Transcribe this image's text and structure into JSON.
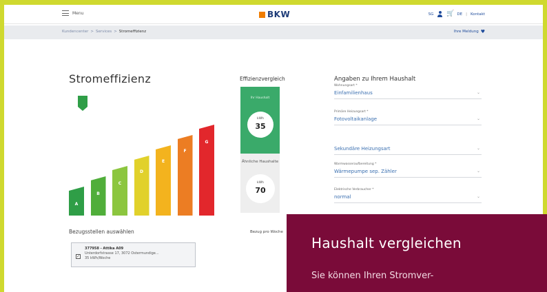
{
  "header": {
    "menu_label": "Menu",
    "logo_text": "BKW",
    "user_short": "SG",
    "language": "DE",
    "separator": "|",
    "contact": "Kontakt"
  },
  "breadcrumb": {
    "items": [
      "Kundencenter",
      "Services",
      "Stromeffizienz"
    ],
    "separator": ">",
    "meldung": "Ihre Meldung"
  },
  "main": {
    "title": "Stromeffizienz",
    "energy_classes": [
      "A",
      "B",
      "C",
      "D",
      "E",
      "F",
      "G"
    ],
    "energy_colors": [
      "#2f9e47",
      "#50ae3a",
      "#8cc63f",
      "#e1d12b",
      "#f3b31e",
      "#ec7d23",
      "#e2272c"
    ]
  },
  "comparison": {
    "title": "Effizienzvergleich",
    "own": {
      "label": "Ihr Haushalt",
      "unit": "kWh",
      "value": "35"
    },
    "similar": {
      "label": "Ähnliche Haushalte",
      "unit": "kWh",
      "value": "70"
    }
  },
  "form": {
    "title": "Angaben zu Ihrem Haushalt",
    "fields": [
      {
        "label": "Wohnungsart *",
        "value": "Einfamilienhaus"
      },
      {
        "label": "Primäre Heizungsart *",
        "value": "Fotovoltaikanlage"
      },
      {
        "label": "",
        "value": "Sekundäre Heizungsart"
      },
      {
        "label": "Warmwasseraufbereitung *",
        "value": "Wärmepumpe sep. Zähler"
      },
      {
        "label": "Elektrische Verbraucher *",
        "value": "normal"
      }
    ]
  },
  "bezug": {
    "title": "Bezugsstellen auswählen",
    "line1": "377958 - Attika A09",
    "line2": "Unterdorfstrasse 17, 3072 Ostermundige...",
    "line3": "35 kWh/Woche",
    "period_label": "Bezug pro Woche"
  },
  "overlay": {
    "title": "Haushalt vergleichen",
    "text": "Sie können Ihren Stromver-",
    "color": "#7a0b39"
  },
  "colors": {
    "frame": "#cfd92f",
    "accent_blue": "#1e4b9b",
    "green_card": "#3aaa6a"
  }
}
